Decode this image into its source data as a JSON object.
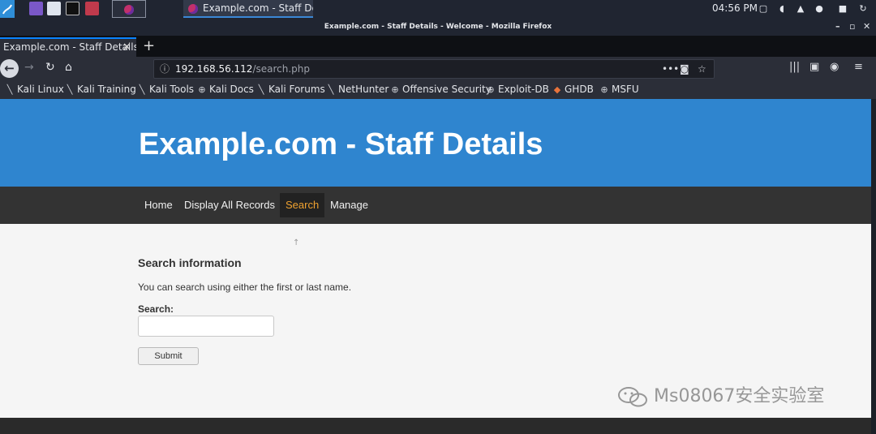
{
  "taskbar": {
    "window_title": "Example.com - Staff Det...",
    "clock": "04:56 PM"
  },
  "browser": {
    "window_title": "Example.com - Staff Details - Welcome - Mozilla Firefox",
    "tab_title": "Example.com - Staff Details",
    "tab_close": "✕",
    "new_tab": "+",
    "url_host": "192.168.56.112",
    "url_path": "/search.php",
    "bookmarks": [
      "Kali Linux",
      "Kali Training",
      "Kali Tools",
      "Kali Docs",
      "Kali Forums",
      "NetHunter",
      "Offensive Security",
      "Exploit-DB",
      "GHDB",
      "MSFU"
    ]
  },
  "site": {
    "title": "Example.com - Staff Details",
    "nav": [
      "Home",
      "Display All Records",
      "Search",
      "Manage"
    ],
    "active_nav": "Search"
  },
  "search": {
    "heading": "Search information",
    "help": "You can search using either the first or last name.",
    "label": "Search:",
    "input_value": "",
    "submit_label": "Submit"
  },
  "watermark": {
    "text": "Ms08067安全实验室"
  },
  "colors": {
    "header": "#2f85cf",
    "nav_bar": "#333333",
    "nav_active_text": "#f0a230",
    "page_bg": "#f5f5f5"
  }
}
